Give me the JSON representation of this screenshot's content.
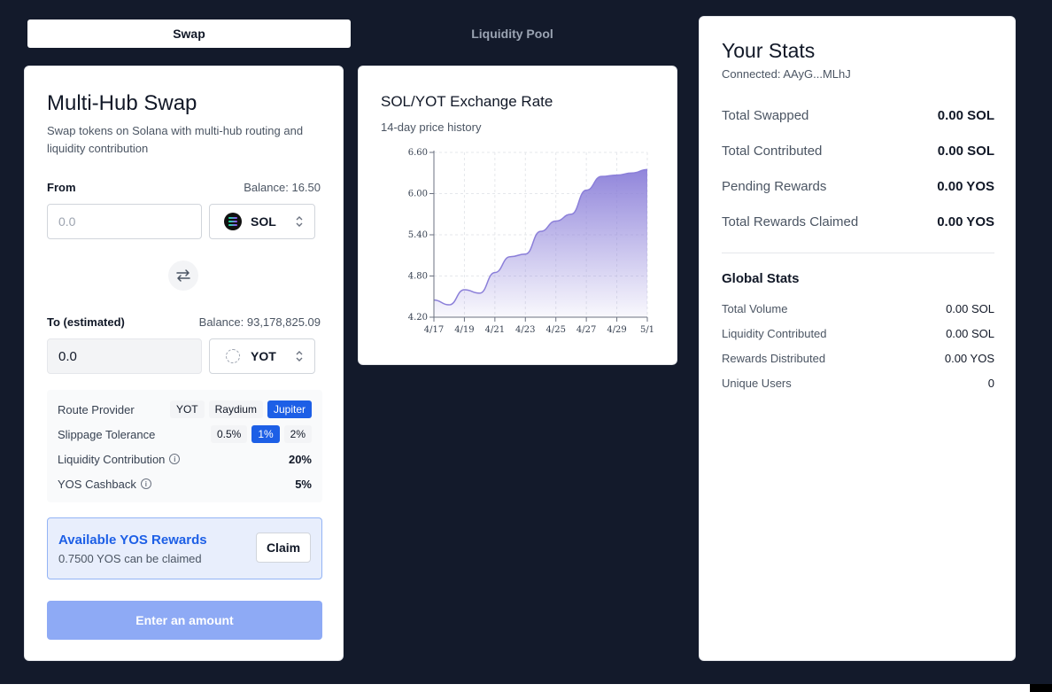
{
  "tabs": [
    {
      "label": "Swap",
      "active": true
    },
    {
      "label": "Liquidity Pool",
      "active": false
    }
  ],
  "swap": {
    "title": "Multi-Hub Swap",
    "description": "Swap tokens on Solana with multi-hub routing and liquidity contribution",
    "from": {
      "label": "From",
      "balance": "Balance: 16.50",
      "placeholder": "0.0",
      "token": "SOL",
      "token_icon": "sol-icon"
    },
    "to": {
      "label": "To (estimated)",
      "balance": "Balance: 93,178,825.09",
      "value": "0.0",
      "token": "YOT",
      "token_icon": "yot-icon"
    },
    "route_provider": {
      "label": "Route Provider",
      "options": [
        "YOT",
        "Raydium",
        "Jupiter"
      ],
      "selected": "Jupiter"
    },
    "slippage": {
      "label": "Slippage Tolerance",
      "options": [
        "0.5%",
        "1%",
        "2%"
      ],
      "selected": "1%"
    },
    "liquidity_contribution": {
      "label": "Liquidity Contribution",
      "value": "20%"
    },
    "cashback": {
      "label": "YOS Cashback",
      "value": "5%"
    },
    "rewards": {
      "title": "Available YOS Rewards",
      "subtitle": "0.7500 YOS can be claimed",
      "claim_label": "Claim"
    },
    "submit_label": "Enter an amount"
  },
  "chart": {
    "title": "SOL/YOT Exchange Rate",
    "subtitle": "14-day price history"
  },
  "chart_data": {
    "type": "area",
    "x": [
      "4/17",
      "4/18",
      "4/19",
      "4/20",
      "4/21",
      "4/22",
      "4/23",
      "4/24",
      "4/25",
      "4/26",
      "4/27",
      "4/28",
      "4/29",
      "4/30",
      "5/1"
    ],
    "values": [
      4.45,
      4.38,
      4.6,
      4.55,
      4.85,
      5.08,
      5.12,
      5.45,
      5.6,
      5.7,
      6.05,
      6.25,
      6.27,
      6.3,
      6.35
    ],
    "xticks": [
      "4/17",
      "4/19",
      "4/21",
      "4/23",
      "4/25",
      "4/27",
      "4/29",
      "5/1"
    ],
    "yticks": [
      "4.20",
      "4.80",
      "5.40",
      "6.00",
      "6.60"
    ],
    "ylim": [
      4.2,
      6.6
    ],
    "grid": true,
    "fill_color": "#8b7fd9"
  },
  "stats": {
    "title": "Your Stats",
    "connected": "Connected: AAyG...MLhJ",
    "user_rows": [
      {
        "label": "Total Swapped",
        "value": "0.00 SOL"
      },
      {
        "label": "Total Contributed",
        "value": "0.00 SOL"
      },
      {
        "label": "Pending Rewards",
        "value": "0.00 YOS"
      },
      {
        "label": "Total Rewards Claimed",
        "value": "0.00 YOS"
      }
    ],
    "global_title": "Global Stats",
    "global_rows": [
      {
        "label": "Total Volume",
        "value": "0.00 SOL"
      },
      {
        "label": "Liquidity Contributed",
        "value": "0.00 SOL"
      },
      {
        "label": "Rewards Distributed",
        "value": "0.00 YOS"
      },
      {
        "label": "Unique Users",
        "value": "0"
      }
    ]
  },
  "colors": {
    "background": "#131a2b",
    "accent": "#1d5fe6",
    "button_disabled": "#8eaaf5"
  }
}
